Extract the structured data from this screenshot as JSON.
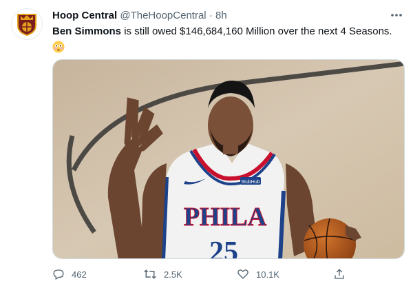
{
  "tweet": {
    "author_name": "Hoop Central",
    "handle": "@TheHoopCentral",
    "separator": "·",
    "time": "8h",
    "mention": "Ben Simmons",
    "text": " is still owed $146,684,160 Million over the next 4 Seasons.",
    "emoji": "flushed-face-emoji"
  },
  "media": {
    "jersey_text": "PHILA",
    "jersey_number": "25",
    "patch_text": "StubHub"
  },
  "actions": {
    "reply_count": "462",
    "retweet_count": "2.5K",
    "like_count": "10.1K"
  },
  "icons": {
    "avatar": "hoop-central-logo",
    "more": "more-icon",
    "reply": "reply-icon",
    "retweet": "retweet-icon",
    "like": "heart-icon",
    "share": "share-icon"
  },
  "colors": {
    "text_primary": "#0f1419",
    "text_secondary": "#536471",
    "jersey_blue": "#1d428a",
    "jersey_red": "#c8102e"
  }
}
